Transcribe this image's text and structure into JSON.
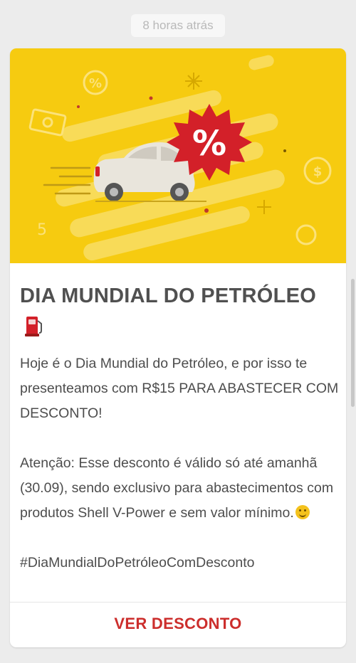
{
  "message": {
    "timestamp": "8 horas atrás",
    "banner": {
      "background_color": "#f6cb10",
      "badge_symbol": "%",
      "badge_color": "#d32029",
      "icons": [
        "percent-coin-icon",
        "banknote-icon",
        "dollar-coin-icon",
        "car-icon",
        "sparkle-icon"
      ]
    },
    "title": "DIA MUNDIAL DO PETRÓLEO",
    "title_icon": "fuel-pump-icon",
    "paragraph_1": "Hoje é o Dia Mundial do Petróleo, e por isso te presenteamos com R$15 PARA ABASTECER COM DESCONTO!",
    "paragraph_2": "Atenção: Esse desconto é válido só até amanhã (30.09), sendo exclusivo para abastecimentos com produtos Shell V-Power e sem valor mínimo.",
    "paragraph_2_icon": "smiley-icon",
    "hashtag": "#DiaMundialDoPetróleoComDesconto",
    "cta_label": "VER DESCONTO",
    "accent_color": "#cc2e2c"
  }
}
